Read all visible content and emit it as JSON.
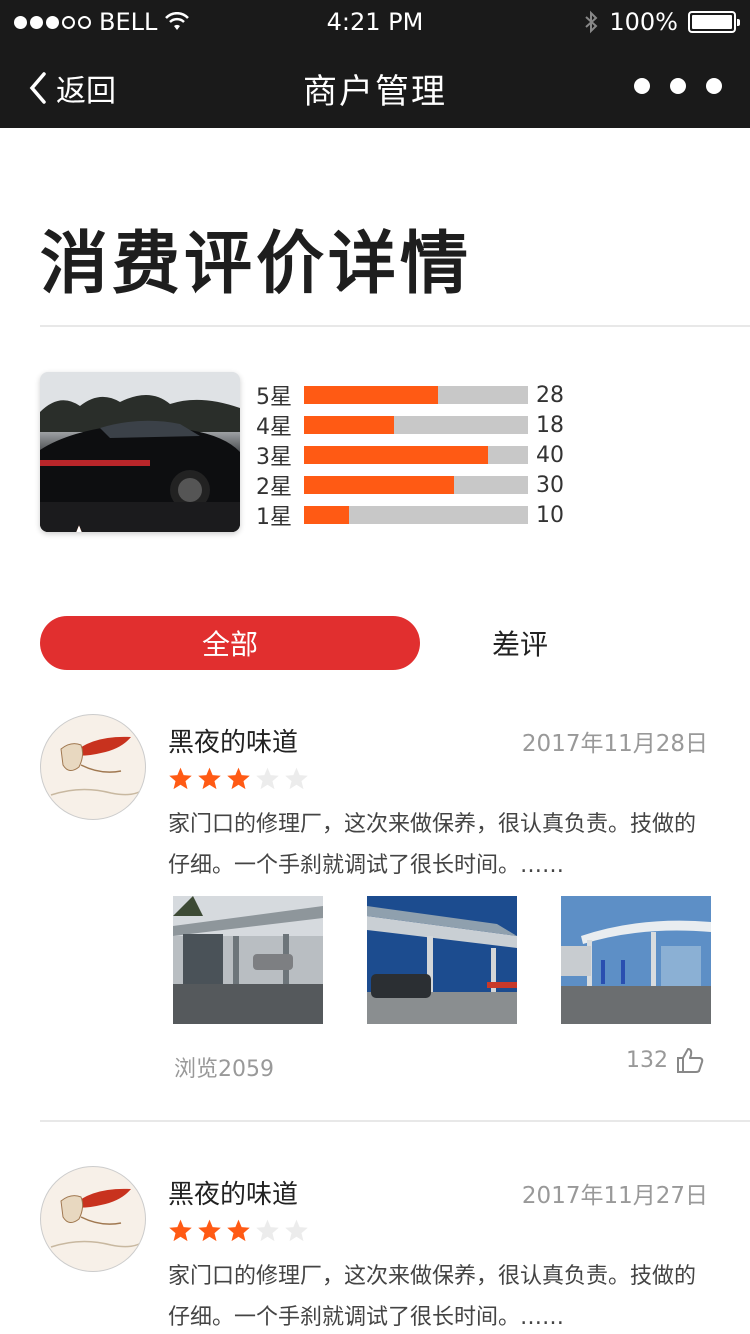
{
  "status_bar": {
    "carrier": "BELL",
    "time": "4:21 PM",
    "battery": "100%"
  },
  "nav": {
    "back_label": "返回",
    "title": "商户管理"
  },
  "page_title": "消费评价详情",
  "summary": {
    "thumb_rating": 3,
    "rows": [
      {
        "label": "5星",
        "count": "28",
        "fill": 0.6
      },
      {
        "label": "4星",
        "count": "18",
        "fill": 0.4
      },
      {
        "label": "3星",
        "count": "40",
        "fill": 0.82
      },
      {
        "label": "2星",
        "count": "30",
        "fill": 0.67
      },
      {
        "label": "1星",
        "count": "10",
        "fill": 0.2
      }
    ]
  },
  "tabs": {
    "all": "全部",
    "bad": "差评"
  },
  "reviews": [
    {
      "name": "黑夜的味道",
      "date": "2017年11月28日",
      "rating": 3,
      "text": "家门口的修理厂，这次来做保养，很认真负责。技做的仔细。一个手刹就调试了很长时间。……",
      "views": "浏览2059",
      "likes": "132"
    },
    {
      "name": "黑夜的味道",
      "date": "2017年11月27日",
      "rating": 3,
      "text": "家门口的修理厂，这次来做保养，很认真负责。技做的仔细。一个手刹就调试了很长时间。……"
    }
  ],
  "colors": {
    "accent": "#ff5a14",
    "tab_active": "#e12f2f",
    "bar_bg": "#1a1a1a"
  }
}
